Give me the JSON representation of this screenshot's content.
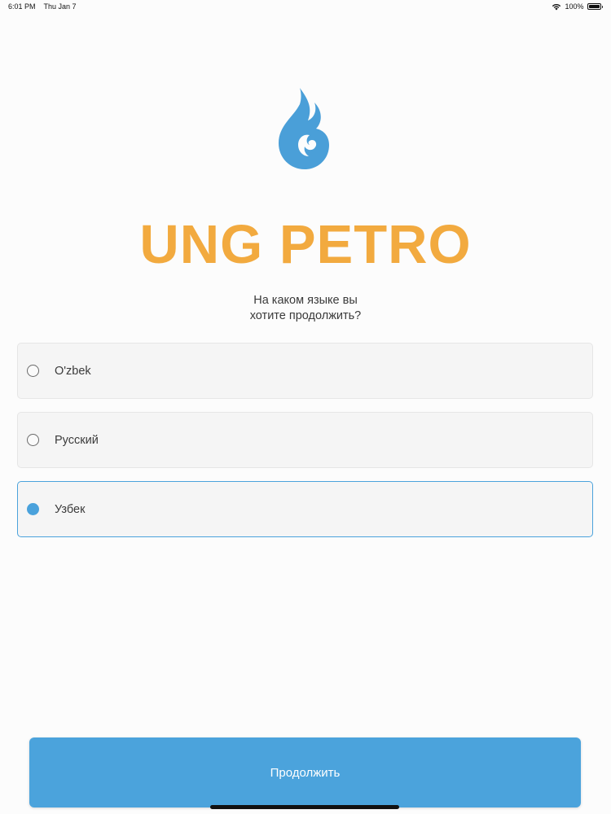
{
  "status_bar": {
    "time": "6:01 PM",
    "date": "Thu Jan 7",
    "battery": "100%",
    "icons": [
      "wifi-icon",
      "battery-icon"
    ]
  },
  "brand": {
    "name": "UNG PETRO",
    "logo_icon": "flame-logo",
    "color": "#f2aa3f",
    "logo_color": "#4a9fd8"
  },
  "prompt": {
    "line1": "На каком языке вы",
    "line2": "хотите продолжить?"
  },
  "languages": {
    "selected": "Узбек",
    "options": [
      {
        "label": "O'zbek",
        "selected": false
      },
      {
        "label": "Русский",
        "selected": false
      },
      {
        "label": "Узбек",
        "selected": true
      }
    ]
  },
  "continue_button": {
    "label": "Продолжить",
    "color": "#4ba3dc"
  }
}
